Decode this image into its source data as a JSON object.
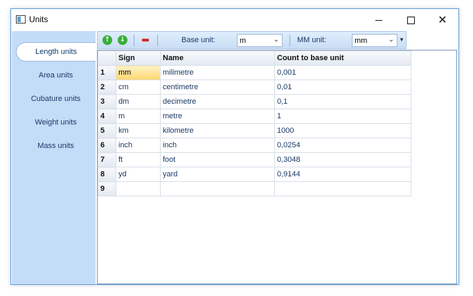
{
  "window": {
    "title": "Units",
    "icon": "app-window-icon"
  },
  "sidebar": {
    "items": [
      {
        "label": "Length units",
        "active": true
      },
      {
        "label": "Area units",
        "active": false
      },
      {
        "label": "Cubature units",
        "active": false
      },
      {
        "label": "Weight units",
        "active": false
      },
      {
        "label": "Mass units",
        "active": false
      }
    ]
  },
  "toolbar": {
    "base_unit_label": "Base unit:",
    "base_unit_value": "m",
    "mm_unit_label": "MM unit:",
    "mm_unit_value": "mm",
    "buttons": [
      "move-up-icon",
      "move-down-icon",
      "delete-icon"
    ],
    "colors": {
      "up_down": "#3aae3a",
      "delete": "#d42a2a"
    }
  },
  "grid": {
    "columns": [
      "",
      "Sign",
      "Name",
      "Count to base unit"
    ],
    "rows": [
      {
        "n": "1",
        "sign": "mm",
        "name": "milimetre",
        "count": "0,001"
      },
      {
        "n": "2",
        "sign": "cm",
        "name": "centimetre",
        "count": "0,01"
      },
      {
        "n": "3",
        "sign": "dm",
        "name": "decimetre",
        "count": "0,1"
      },
      {
        "n": "4",
        "sign": "m",
        "name": "metre",
        "count": "1"
      },
      {
        "n": "5",
        "sign": "km",
        "name": "kilometre",
        "count": "1000"
      },
      {
        "n": "6",
        "sign": "inch",
        "name": "inch",
        "count": "0,0254"
      },
      {
        "n": "7",
        "sign": "ft",
        "name": "foot",
        "count": "0,3048"
      },
      {
        "n": "8",
        "sign": "yd",
        "name": "yard",
        "count": "0,9144"
      },
      {
        "n": "9",
        "sign": "",
        "name": "",
        "count": ""
      }
    ],
    "selected_cell": "rows.0.sign",
    "selection_color": "#ffd66b"
  }
}
